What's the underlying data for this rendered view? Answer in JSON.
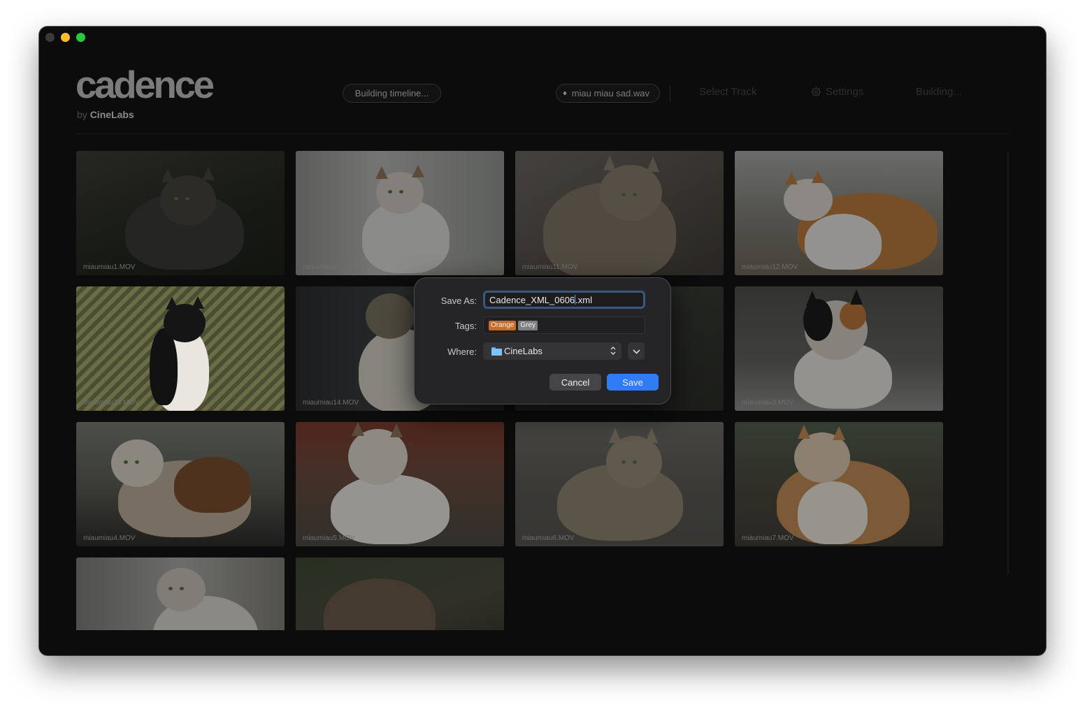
{
  "window": {
    "traffic_lights": [
      "close",
      "minimize",
      "zoom"
    ]
  },
  "header": {
    "logo": "cadence",
    "by_prefix": "by",
    "by_company": "CineLabs",
    "status_pill": "Building timeline...",
    "audio_pill": "miau miau sad.wav",
    "select_track": "Select Track",
    "settings": "Settings",
    "settings_icon": "gear-icon",
    "building": "Building..."
  },
  "clips": [
    {
      "name": "miaumiau1.MOV"
    },
    {
      "name": "miaumiau10.MOV"
    },
    {
      "name": "miaumiau11.MOV"
    },
    {
      "name": "miaumiau12.MOV"
    },
    {
      "name": "miaumiau13.MOV"
    },
    {
      "name": "miaumiau14.MOV"
    },
    {
      "name": ""
    },
    {
      "name": "miaumiau3.MOV"
    },
    {
      "name": "miaumiau4.MOV"
    },
    {
      "name": "miaumiau5.MOV"
    },
    {
      "name": "miaumiau6.MOV"
    },
    {
      "name": "miaumiau7.MOV"
    },
    {
      "name": ""
    },
    {
      "name": ""
    }
  ],
  "dialog": {
    "save_as_label": "Save As:",
    "filename_before_caret": "Cadence_XML_0606",
    "filename_after_caret": ".xml",
    "tags_label": "Tags:",
    "tags": [
      {
        "label": "Orange",
        "color": "#c86b26"
      },
      {
        "label": "Grey",
        "color": "#7f7f7f"
      }
    ],
    "where_label": "Where:",
    "where_value": "CineLabs",
    "cancel": "Cancel",
    "save": "Save"
  },
  "colors": {
    "accent": "#2f7cf6",
    "window_bg": "#0c0c0c"
  }
}
